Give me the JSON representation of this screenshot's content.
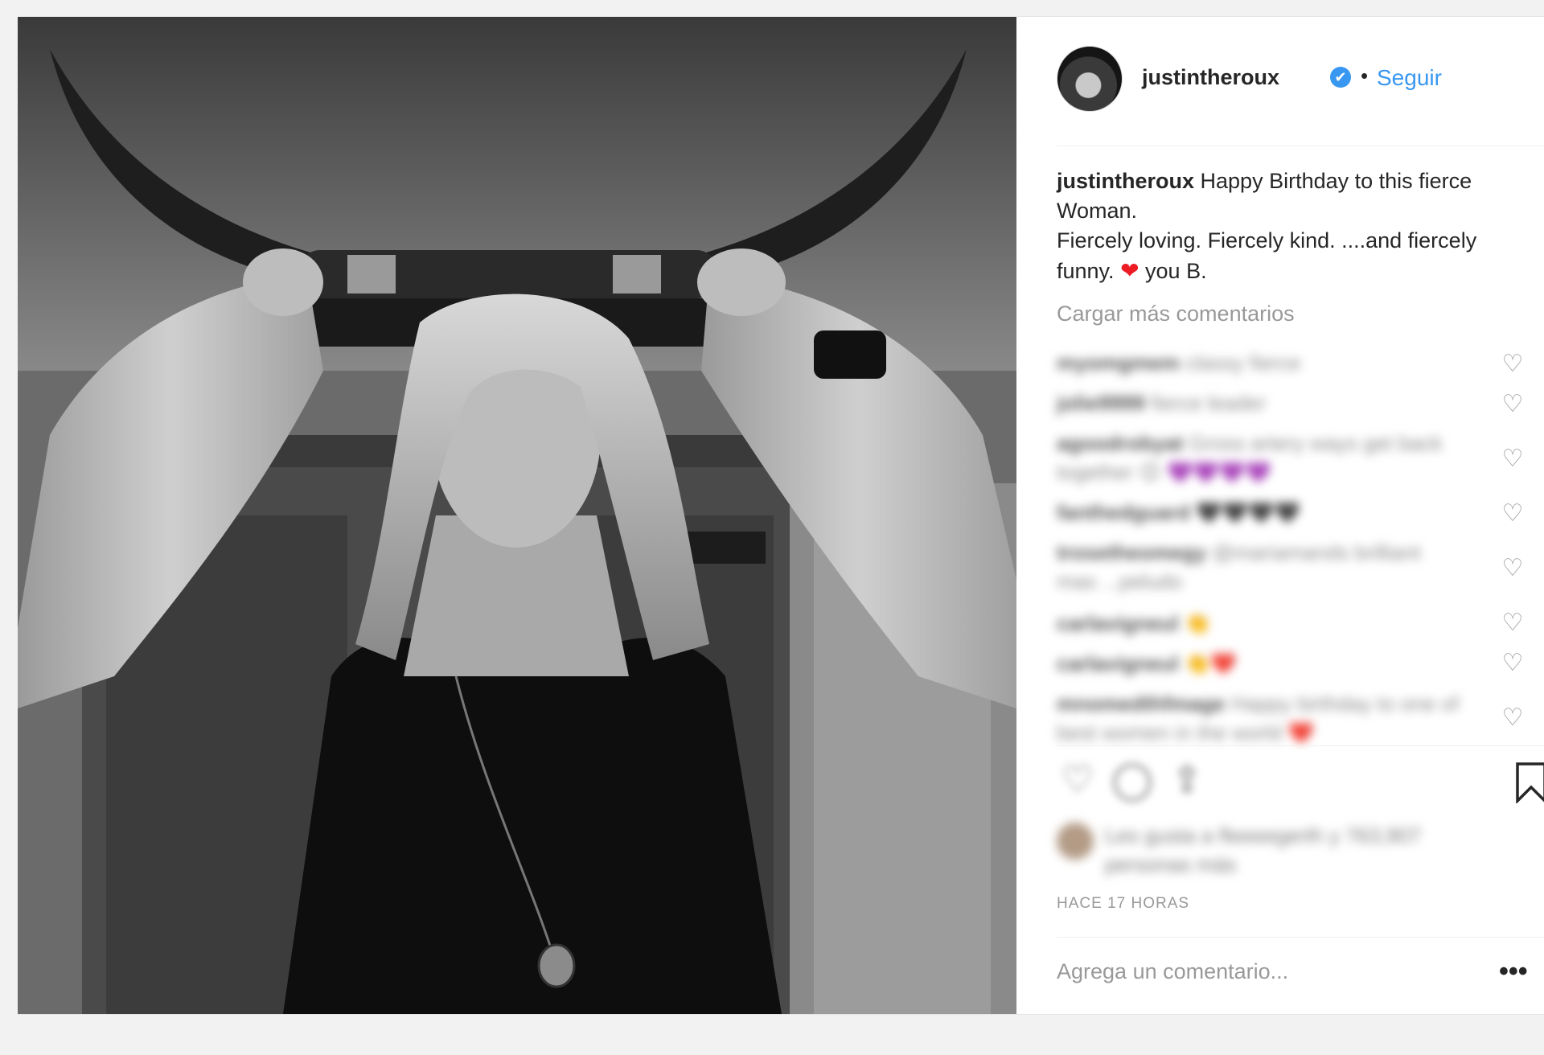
{
  "post": {
    "username": "justintheroux",
    "verified_glyph": "✔",
    "separator": "•",
    "follow_label": "Seguir",
    "caption": {
      "user": "justintheroux",
      "line1": " Happy Birthday to this fierce Woman.",
      "line2": "Fiercely loving. Fiercely kind. ....and fiercely funny. ",
      "heart": "❤",
      "line3": " you B."
    },
    "load_more": "Cargar más comentarios",
    "comments": [
      {
        "user": "myomgmem",
        "text": "classy fierce"
      },
      {
        "user": "jolie9999",
        "text": "fierce leader"
      },
      {
        "user": "agoodrobyat",
        "text": "Gross artery ways get back together 😊 💜💜💜💜"
      },
      {
        "user": "fanthedguard",
        "text": "🖤🖤🖤🖤"
      },
      {
        "user": "trosetheomegy",
        "text": "@mariamands brilliant mas ...peludo"
      },
      {
        "user": "carlavigneul",
        "text": "👏"
      },
      {
        "user": "carlavigneul",
        "text": "👏❤️"
      },
      {
        "user": "mnomedthfmage",
        "text": "Happy birthday to one of best women in the world ❤️"
      }
    ],
    "likes_text": "Les gusta a fleeeegerth y 763,907 personas más",
    "timestamp": "HACE 17 HORAS",
    "add_comment_placeholder": "Agrega un comentario...",
    "more_label": "•••",
    "icons": [
      "heart-outline-icon",
      "comment-icon",
      "share-icon",
      "bookmark-icon",
      "verified-badge-icon",
      "more-options-icon"
    ],
    "colors": {
      "link": "#3897f0",
      "text": "#262626",
      "muted": "#999999",
      "heart": "#ed1c24"
    }
  }
}
